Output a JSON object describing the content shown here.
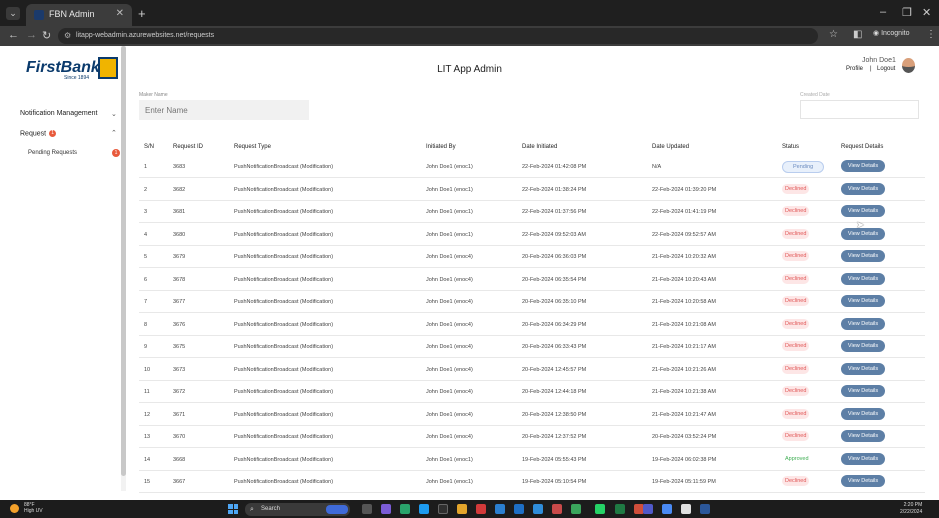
{
  "browser": {
    "tab_title": "FBN Admin",
    "url": "litapp-webadmin.azurewebsites.net/requests",
    "incognito_label": "Incognito"
  },
  "app": {
    "brand": "FirstBank",
    "brand_sub": "Since 1894",
    "title": "LIT App Admin",
    "user_name": "John Doe1",
    "profile_link": "Profile",
    "separator": "|",
    "logout_link": "Logout"
  },
  "sidebar": {
    "notification_label": "Notification Management",
    "request_label": "Request",
    "request_badge": "1",
    "pending_label": "Pending Requests",
    "pending_badge": "1"
  },
  "filters": {
    "maker_label": "Maker Name",
    "maker_placeholder": "Enter Name",
    "created_date_label": "Created Date"
  },
  "table": {
    "headers": {
      "sn": "S/N",
      "request_id": "Request ID",
      "request_type": "Request Type",
      "initiated_by": "Initiated By",
      "date_initiated": "Date Initiated",
      "date_updated": "Date Updated",
      "status": "Status",
      "details": "Request Details"
    },
    "view_label": "View Details",
    "rows": [
      {
        "sn": "1",
        "id": "3683",
        "type": "PushNotificationBroadcast (Modification)",
        "by": "John Doe1 (enoc1)",
        "initiated": "22-Feb-2024 01:42:08 PM",
        "updated": "N/A",
        "status": "Pending"
      },
      {
        "sn": "2",
        "id": "3682",
        "type": "PushNotificationBroadcast (Modification)",
        "by": "John Doe1 (enoc1)",
        "initiated": "22-Feb-2024 01:38:24 PM",
        "updated": "22-Feb-2024 01:39:20 PM",
        "status": "Declined"
      },
      {
        "sn": "3",
        "id": "3681",
        "type": "PushNotificationBroadcast (Modification)",
        "by": "John Doe1 (enoc1)",
        "initiated": "22-Feb-2024 01:37:56 PM",
        "updated": "22-Feb-2024 01:41:19 PM",
        "status": "Declined"
      },
      {
        "sn": "4",
        "id": "3680",
        "type": "PushNotificationBroadcast (Modification)",
        "by": "John Doe1 (enoc1)",
        "initiated": "22-Feb-2024 09:52:03 AM",
        "updated": "22-Feb-2024 09:52:57 AM",
        "status": "Declined"
      },
      {
        "sn": "5",
        "id": "3679",
        "type": "PushNotificationBroadcast (Modification)",
        "by": "John Doe1 (enoc4)",
        "initiated": "20-Feb-2024 06:36:03 PM",
        "updated": "21-Feb-2024 10:20:32 AM",
        "status": "Declined"
      },
      {
        "sn": "6",
        "id": "3678",
        "type": "PushNotificationBroadcast (Modification)",
        "by": "John Doe1 (enoc4)",
        "initiated": "20-Feb-2024 06:35:54 PM",
        "updated": "21-Feb-2024 10:20:43 AM",
        "status": "Declined"
      },
      {
        "sn": "7",
        "id": "3677",
        "type": "PushNotificationBroadcast (Modification)",
        "by": "John Doe1 (enoc4)",
        "initiated": "20-Feb-2024 06:35:10 PM",
        "updated": "21-Feb-2024 10:20:58 AM",
        "status": "Declined"
      },
      {
        "sn": "8",
        "id": "3676",
        "type": "PushNotificationBroadcast (Modification)",
        "by": "John Doe1 (enoc4)",
        "initiated": "20-Feb-2024 06:34:29 PM",
        "updated": "21-Feb-2024 10:21:08 AM",
        "status": "Declined"
      },
      {
        "sn": "9",
        "id": "3675",
        "type": "PushNotificationBroadcast (Modification)",
        "by": "John Doe1 (enoc4)",
        "initiated": "20-Feb-2024 06:33:43 PM",
        "updated": "21-Feb-2024 10:21:17 AM",
        "status": "Declined"
      },
      {
        "sn": "10",
        "id": "3673",
        "type": "PushNotificationBroadcast (Modification)",
        "by": "John Doe1 (enoc4)",
        "initiated": "20-Feb-2024 12:45:57 PM",
        "updated": "21-Feb-2024 10:21:26 AM",
        "status": "Declined"
      },
      {
        "sn": "11",
        "id": "3672",
        "type": "PushNotificationBroadcast (Modification)",
        "by": "John Doe1 (enoc4)",
        "initiated": "20-Feb-2024 12:44:18 PM",
        "updated": "21-Feb-2024 10:21:38 AM",
        "status": "Declined"
      },
      {
        "sn": "12",
        "id": "3671",
        "type": "PushNotificationBroadcast (Modification)",
        "by": "John Doe1 (enoc4)",
        "initiated": "20-Feb-2024 12:38:50 PM",
        "updated": "21-Feb-2024 10:21:47 AM",
        "status": "Declined"
      },
      {
        "sn": "13",
        "id": "3670",
        "type": "PushNotificationBroadcast (Modification)",
        "by": "John Doe1 (enoc4)",
        "initiated": "20-Feb-2024 12:37:52 PM",
        "updated": "20-Feb-2024 03:52:24 PM",
        "status": "Declined"
      },
      {
        "sn": "14",
        "id": "3668",
        "type": "PushNotificationBroadcast (Modification)",
        "by": "John Doe1 (enoc1)",
        "initiated": "19-Feb-2024 05:55:43 PM",
        "updated": "19-Feb-2024 06:02:38 PM",
        "status": "Approved"
      },
      {
        "sn": "15",
        "id": "3667",
        "type": "PushNotificationBroadcast (Modification)",
        "by": "John Doe1 (enoc1)",
        "initiated": "19-Feb-2024 05:10:54 PM",
        "updated": "19-Feb-2024 05:11:59 PM",
        "status": "Declined"
      }
    ]
  },
  "taskbar": {
    "temp": "88°F",
    "weather": "High UV",
    "search_label": "Search",
    "time": "2:20 PM",
    "date": "2/22/2024"
  },
  "colors": {
    "brand_blue": "#0a3a6c",
    "brand_gold": "#f0b400",
    "view_button": "#5d7fa6",
    "declined": "#e05555",
    "approved": "#3fae53",
    "pending": "#6b8bbf"
  }
}
